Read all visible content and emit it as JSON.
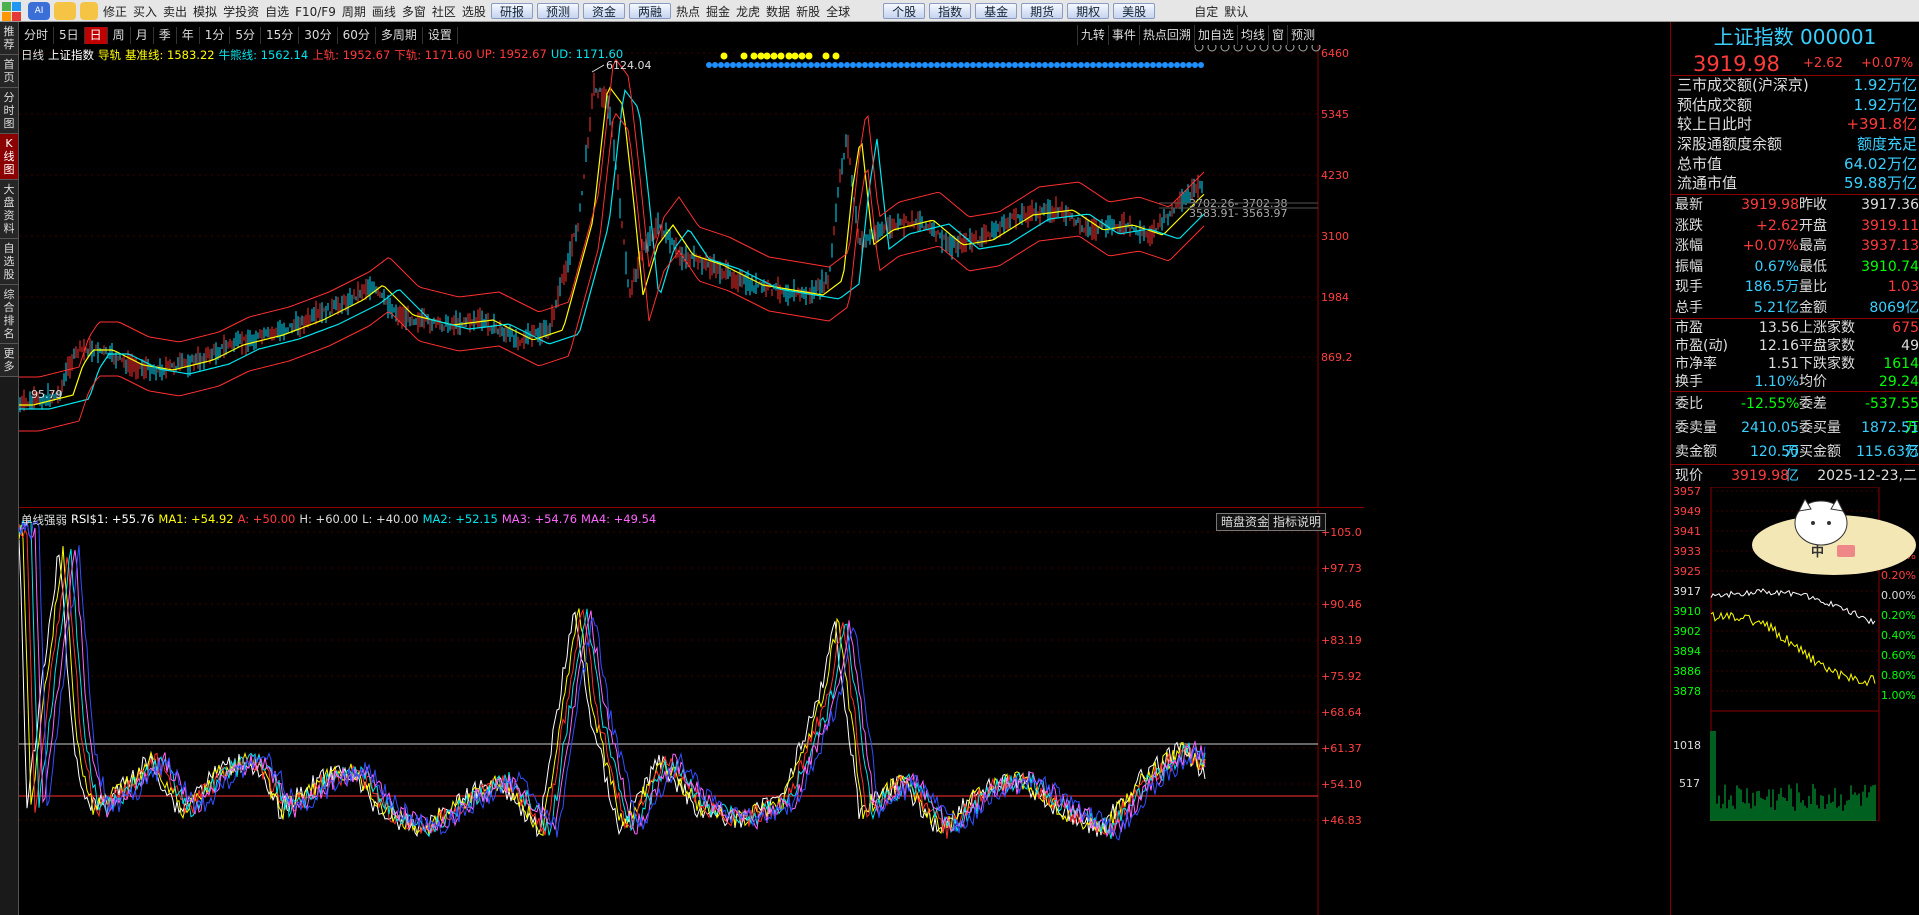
{
  "toolbar": {
    "buttons": [
      "修正",
      "买入",
      "卖出",
      "模拟",
      "学投资",
      "自选",
      "F10/F9",
      "周期",
      "画线",
      "多窗",
      "社区",
      "选股"
    ],
    "buttons2": [
      "研报",
      "预测",
      "资金",
      "两融"
    ],
    "buttons3": [
      "热点",
      "掘金",
      "龙虎",
      "数据",
      "新股",
      "全球"
    ],
    "buttons4": [
      "个股",
      "指数",
      "基金",
      "期货",
      "期权",
      "美股"
    ],
    "buttons5": [
      "自定",
      "默认"
    ]
  },
  "left_sidebar": [
    "推荐",
    "首页",
    "分时图",
    "K线图",
    "大盘资料",
    "自选股",
    "综合排名",
    "更多"
  ],
  "period_tabs": [
    "分时",
    "5日",
    "日",
    "周",
    "月",
    "季",
    "年",
    "1分",
    "5分",
    "15分",
    "30分",
    "60分",
    "多周期",
    "设置"
  ],
  "active_period": "日",
  "right_tabs": [
    "九转",
    "事件",
    "热点回溯",
    "加自选",
    "均线",
    "窗",
    "预测"
  ],
  "main_chart": {
    "info": [
      {
        "t": "日线",
        "c": "#dddddd"
      },
      {
        "t": "上证指数",
        "c": "#ffffff"
      },
      {
        "t": "导轨",
        "c": "#ffff00"
      },
      {
        "t": "基准线: 1583.22",
        "c": "#ffff00"
      },
      {
        "t": "牛熊线: 1562.14",
        "c": "#00e5ee"
      },
      {
        "t": "上轨: 1952.67",
        "c": "#ff3b3b"
      },
      {
        "t": "下轨: 1171.60",
        "c": "#ff3b3b"
      },
      {
        "t": "UP: 1952.67",
        "c": "#ff3b3b"
      },
      {
        "t": "UD: 1171.60",
        "c": "#00e5ee"
      }
    ],
    "y_ticks": [
      "6460",
      "5345",
      "4230",
      "3100",
      "1984",
      "869.2"
    ],
    "peak_label": "6124.04",
    "low_label": "95.79",
    "annot1": "3702.26- 3702.38",
    "annot2": "3583.91- 3563.97"
  },
  "sub_chart": {
    "info": [
      {
        "t": "单线强弱",
        "c": "#dddddd"
      },
      {
        "t": "RSI$1: +55.76",
        "c": "#ffffff"
      },
      {
        "t": "MA1: +54.92",
        "c": "#ffff00"
      },
      {
        "t": "A: +50.00",
        "c": "#ff3b3b"
      },
      {
        "t": "H: +60.00",
        "c": "#dddddd"
      },
      {
        "t": "L: +40.00",
        "c": "#dddddd"
      },
      {
        "t": "MA2: +52.15",
        "c": "#00e5ee"
      },
      {
        "t": "MA3: +54.76",
        "c": "#ff66ff"
      },
      {
        "t": "MA4: +49.54",
        "c": "#ff66ff"
      }
    ],
    "buttons": [
      "暗盘资金",
      "指标说明"
    ],
    "y_ticks": [
      "+105.0",
      "+97.73",
      "+90.46",
      "+83.19",
      "+75.92",
      "+68.64",
      "+61.37",
      "+54.10",
      "+46.83"
    ]
  },
  "right_panel": {
    "title": "上证指数 000001",
    "price": "3919.98",
    "change": "+2.62",
    "pct": "+0.07%",
    "summary": [
      {
        "l": "三市成交额(沪深京)",
        "v": "1.92万亿",
        "c": "#39d0ff"
      },
      {
        "l": "预估成交额",
        "v": "1.92万亿",
        "c": "#39d0ff"
      },
      {
        "l": "较上日此时",
        "v": "+391.8亿",
        "c": "#ff3b3b"
      },
      {
        "l": "深股通额度余额",
        "v": "额度充足",
        "c": "#39d0ff"
      },
      {
        "l": "总市值",
        "v": "64.02万亿",
        "c": "#39d0ff"
      },
      {
        "l": "流通市值",
        "v": "59.88万亿",
        "c": "#39d0ff"
      }
    ],
    "quotes": [
      [
        "最新",
        "3919.98",
        "#ff3b3b",
        "昨收",
        "3917.36",
        "#dddddd"
      ],
      [
        "涨跌",
        "+2.62",
        "#ff3b3b",
        "开盘",
        "3919.11",
        "#ff3b3b"
      ],
      [
        "涨幅",
        "+0.07%",
        "#ff3b3b",
        "最高",
        "3937.13",
        "#ff3b3b"
      ],
      [
        "振幅",
        "0.67%",
        "#39d0ff",
        "最低",
        "3910.74",
        "#00ff00"
      ],
      [
        "现手",
        "186.5万",
        "#39d0ff",
        "量比",
        "1.03",
        "#ff3b3b"
      ],
      [
        "总手",
        "5.21亿",
        "#39d0ff",
        "金额",
        "8069亿",
        "#39d0ff"
      ]
    ],
    "stats": [
      [
        "市盈",
        "13.56",
        "#dddddd",
        "上涨家数",
        "675",
        "#ff3b3b"
      ],
      [
        "市盈(动)",
        "12.16",
        "#dddddd",
        "平盘家数",
        "49",
        "#dddddd"
      ],
      [
        "市净率",
        "1.51",
        "#dddddd",
        "下跌家数",
        "1614",
        "#00ff00"
      ],
      [
        "换手",
        "1.10%",
        "#39d0ff",
        "均价",
        "29.24",
        "#00ff00"
      ]
    ],
    "orders": [
      [
        "委比",
        "-12.55%",
        "#00ff00",
        "委差",
        "-537.55万",
        "#00ff00"
      ],
      [
        "委卖量",
        "2410.05万",
        "#39d0ff",
        "委买量",
        "1872.51万",
        "#39d0ff"
      ],
      [
        "卖金额",
        "120.50亿",
        "#39d0ff",
        "买金额",
        "115.63亿",
        "#39d0ff"
      ]
    ],
    "mini_header": {
      "label": "现价",
      "value": "3919.98",
      "date": "2025-12-23,二"
    },
    "mini_y_left": [
      "3957",
      "3949",
      "3941",
      "3933",
      "3925",
      "3917",
      "3910",
      "3902",
      "3894",
      "3886",
      "3878"
    ],
    "mini_y_right": [
      "0.40%",
      "0.20%",
      "0.00%",
      "0.20%",
      "0.40%",
      "0.60%",
      "0.80%",
      "1.00%"
    ],
    "mini_vol": [
      "1018",
      "517"
    ],
    "mascot_text": "中"
  }
}
